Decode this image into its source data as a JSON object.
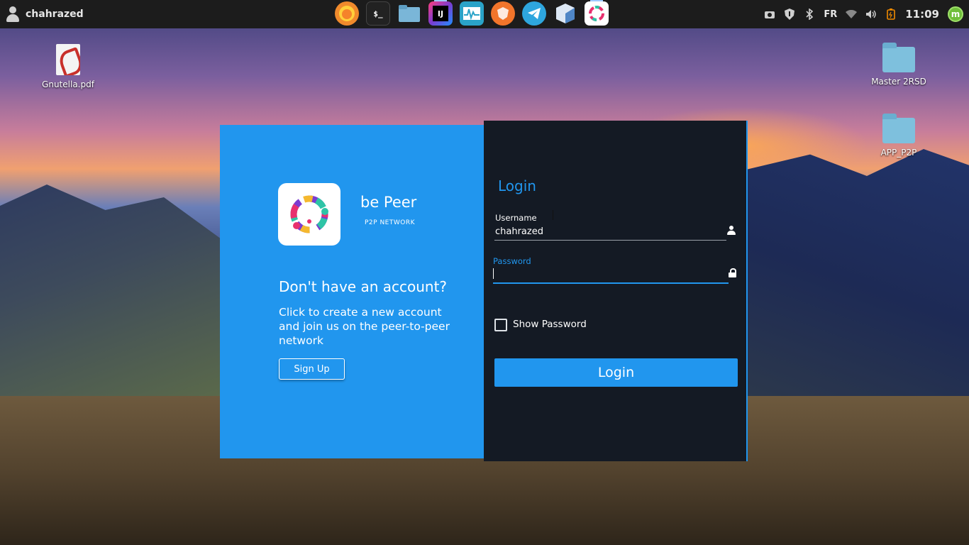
{
  "panel": {
    "user_name": "chahrazed",
    "dock": [
      {
        "name": "firefox",
        "color": "#f08a2c",
        "label": ""
      },
      {
        "name": "terminal",
        "color": "#222222",
        "label": "$_"
      },
      {
        "name": "files",
        "color": "#7ab6d8",
        "label": ""
      },
      {
        "name": "intellij",
        "color": "#7b3bd1",
        "label": "IJ"
      },
      {
        "name": "system-monitor",
        "color": "#2aa3c8",
        "label": ""
      },
      {
        "name": "brave",
        "color": "#f2752b",
        "label": ""
      },
      {
        "name": "telegram",
        "color": "#2ea6de",
        "label": ""
      },
      {
        "name": "virtualbox",
        "color": "#4f86c6",
        "label": ""
      },
      {
        "name": "bepeer",
        "color": "#ffffff",
        "label": ""
      }
    ],
    "keyboard_layout": "FR",
    "clock": "11:09"
  },
  "desktop": {
    "icons": [
      {
        "label": "Gnutella.pdf",
        "type": "pdf"
      },
      {
        "label": "Master 2RSD",
        "type": "folder"
      },
      {
        "label": "APP_P2P",
        "type": "folder"
      }
    ]
  },
  "app": {
    "brand_name": "be Peer",
    "tagline": "P2P NETWORK",
    "signup_heading": "Don't have an account?",
    "signup_description": "Click to create a new account and join us on the peer-to-peer network",
    "signup_button": "Sign Up",
    "login_title": "Login",
    "username_label": "Username",
    "username_value": "chahrazed",
    "password_label": "Password",
    "password_value": "",
    "show_password_label": "Show Password",
    "login_button": "Login"
  },
  "colors": {
    "accent": "#2196ee",
    "login_panel_bg": "#141a24",
    "taskbar_bg": "#1c1c1c"
  }
}
